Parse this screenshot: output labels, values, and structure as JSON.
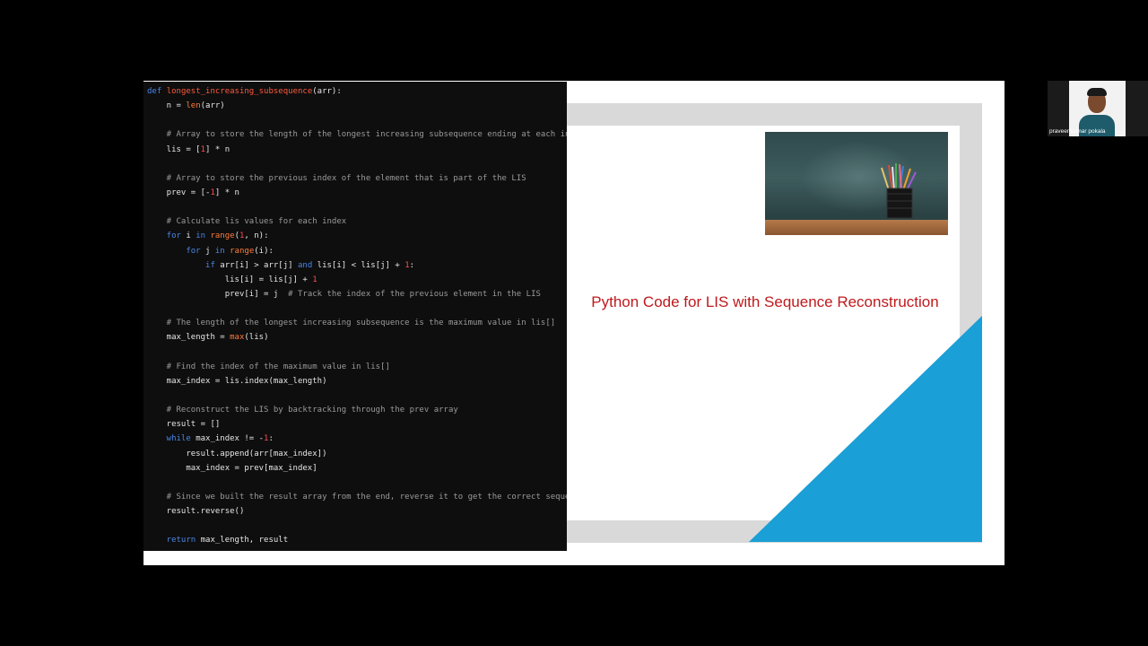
{
  "slide": {
    "title": "Python Code for LIS with Sequence Reconstruction",
    "image_icon": "pencil-cup-photo",
    "colors": {
      "title": "#c0191c",
      "accent_blue": "#1a9fd6",
      "frame_grey": "#d9d9d9"
    }
  },
  "code": {
    "language": "python",
    "lines": [
      [
        [
          "kw",
          "def "
        ],
        [
          "fn",
          "longest_increasing_subsequence"
        ],
        [
          "pl",
          "(arr):"
        ]
      ],
      [
        [
          "pl",
          "    n = "
        ],
        [
          "bi",
          "len"
        ],
        [
          "pl",
          "(arr)"
        ]
      ],
      [],
      [
        [
          "cm",
          "    # Array to store the length of the longest increasing subsequence ending at each index"
        ]
      ],
      [
        [
          "pl",
          "    lis = ["
        ],
        [
          "num",
          "1"
        ],
        [
          "pl",
          "] * n"
        ]
      ],
      [],
      [
        [
          "cm",
          "    # Array to store the previous index of the element that is part of the LIS"
        ]
      ],
      [
        [
          "pl",
          "    prev = [-"
        ],
        [
          "num",
          "1"
        ],
        [
          "pl",
          "] * n"
        ]
      ],
      [],
      [
        [
          "cm",
          "    # Calculate lis values for each index"
        ]
      ],
      [
        [
          "kw",
          "    for "
        ],
        [
          "pl",
          "i "
        ],
        [
          "kw",
          "in "
        ],
        [
          "bi",
          "range"
        ],
        [
          "pl",
          "("
        ],
        [
          "num",
          "1"
        ],
        [
          "pl",
          ", n):"
        ]
      ],
      [
        [
          "kw",
          "        for "
        ],
        [
          "pl",
          "j "
        ],
        [
          "kw",
          "in "
        ],
        [
          "bi",
          "range"
        ],
        [
          "pl",
          "(i):"
        ]
      ],
      [
        [
          "kw",
          "            if "
        ],
        [
          "pl",
          "arr[i] > arr[j] "
        ],
        [
          "kw",
          "and "
        ],
        [
          "pl",
          "lis[i] < lis[j] + "
        ],
        [
          "num",
          "1"
        ],
        [
          "pl",
          ":"
        ]
      ],
      [
        [
          "pl",
          "                lis[i] = lis[j] + "
        ],
        [
          "num",
          "1"
        ]
      ],
      [
        [
          "pl",
          "                prev[i] = j  "
        ],
        [
          "cm",
          "# Track the index of the previous element in the LIS"
        ]
      ],
      [],
      [
        [
          "cm",
          "    # The length of the longest increasing subsequence is the maximum value in lis[]"
        ]
      ],
      [
        [
          "pl",
          "    max_length = "
        ],
        [
          "bi",
          "max"
        ],
        [
          "pl",
          "(lis)"
        ]
      ],
      [],
      [
        [
          "cm",
          "    # Find the index of the maximum value in lis[]"
        ]
      ],
      [
        [
          "pl",
          "    max_index = lis.index(max_length)"
        ]
      ],
      [],
      [
        [
          "cm",
          "    # Reconstruct the LIS by backtracking through the prev array"
        ]
      ],
      [
        [
          "pl",
          "    result = []"
        ]
      ],
      [
        [
          "kw",
          "    while "
        ],
        [
          "pl",
          "max_index != -"
        ],
        [
          "num",
          "1"
        ],
        [
          "pl",
          ":"
        ]
      ],
      [
        [
          "pl",
          "        result.append(arr[max_index])"
        ]
      ],
      [
        [
          "pl",
          "        max_index = prev[max_index]"
        ]
      ],
      [],
      [
        [
          "cm",
          "    # Since we built the result array from the end, reverse it to get the correct sequence"
        ]
      ],
      [
        [
          "pl",
          "    result.reverse()"
        ]
      ],
      [],
      [
        [
          "kw",
          "    return "
        ],
        [
          "pl",
          "max_length, result"
        ]
      ]
    ]
  },
  "webcam": {
    "participant_name": "praveenkumar pokala",
    "icon": "participant-video-thumbnail"
  }
}
